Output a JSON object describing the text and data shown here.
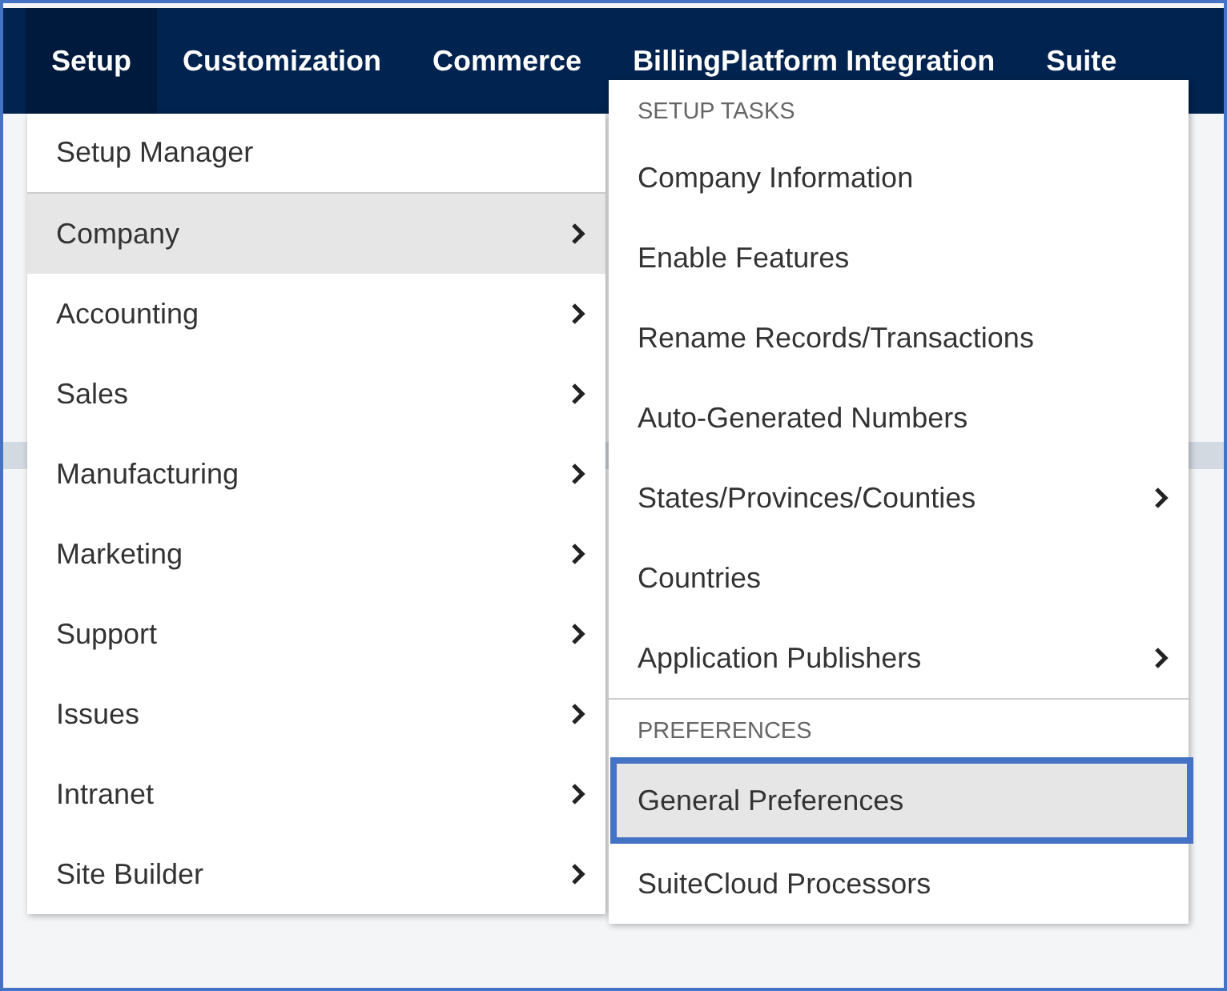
{
  "nav": [
    {
      "label": "Setup",
      "selected": true
    },
    {
      "label": "Customization",
      "selected": false
    },
    {
      "label": "Commerce",
      "selected": false
    },
    {
      "label": "BillingPlatform Integration",
      "selected": false
    },
    {
      "label": "Suite",
      "selected": false
    }
  ],
  "menu": [
    {
      "label": "Setup Manager",
      "selected": false,
      "submenu": false
    },
    {
      "label": "Company",
      "selected": true,
      "submenu": true
    },
    {
      "label": "Accounting",
      "selected": false,
      "submenu": true
    },
    {
      "label": "Sales",
      "selected": false,
      "submenu": true
    },
    {
      "label": "Manufacturing",
      "selected": false,
      "submenu": true
    },
    {
      "label": "Marketing",
      "selected": false,
      "submenu": true
    },
    {
      "label": "Support",
      "selected": false,
      "submenu": true
    },
    {
      "label": "Issues",
      "selected": false,
      "submenu": true
    },
    {
      "label": "Intranet",
      "selected": false,
      "submenu": true
    },
    {
      "label": "Site Builder",
      "selected": false,
      "submenu": true
    }
  ],
  "submenu": [
    {
      "heading": "SETUP TASKS",
      "items": [
        {
          "label": "Company Information",
          "selected": false,
          "submenu": false,
          "highlighted": false
        },
        {
          "label": "Enable Features",
          "selected": false,
          "submenu": false,
          "highlighted": false
        },
        {
          "label": "Rename Records/Transactions",
          "selected": false,
          "submenu": false,
          "highlighted": false
        },
        {
          "label": "Auto-Generated Numbers",
          "selected": false,
          "submenu": false,
          "highlighted": false
        },
        {
          "label": "States/Provinces/Counties",
          "selected": false,
          "submenu": true,
          "highlighted": false
        },
        {
          "label": "Countries",
          "selected": false,
          "submenu": false,
          "highlighted": false
        },
        {
          "label": "Application Publishers",
          "selected": false,
          "submenu": true,
          "highlighted": false
        }
      ]
    },
    {
      "heading": "PREFERENCES",
      "items": [
        {
          "label": "General Preferences",
          "selected": true,
          "submenu": false,
          "highlighted": true
        },
        {
          "label": "SuiteCloud Processors",
          "selected": false,
          "submenu": false,
          "highlighted": false
        }
      ]
    }
  ]
}
